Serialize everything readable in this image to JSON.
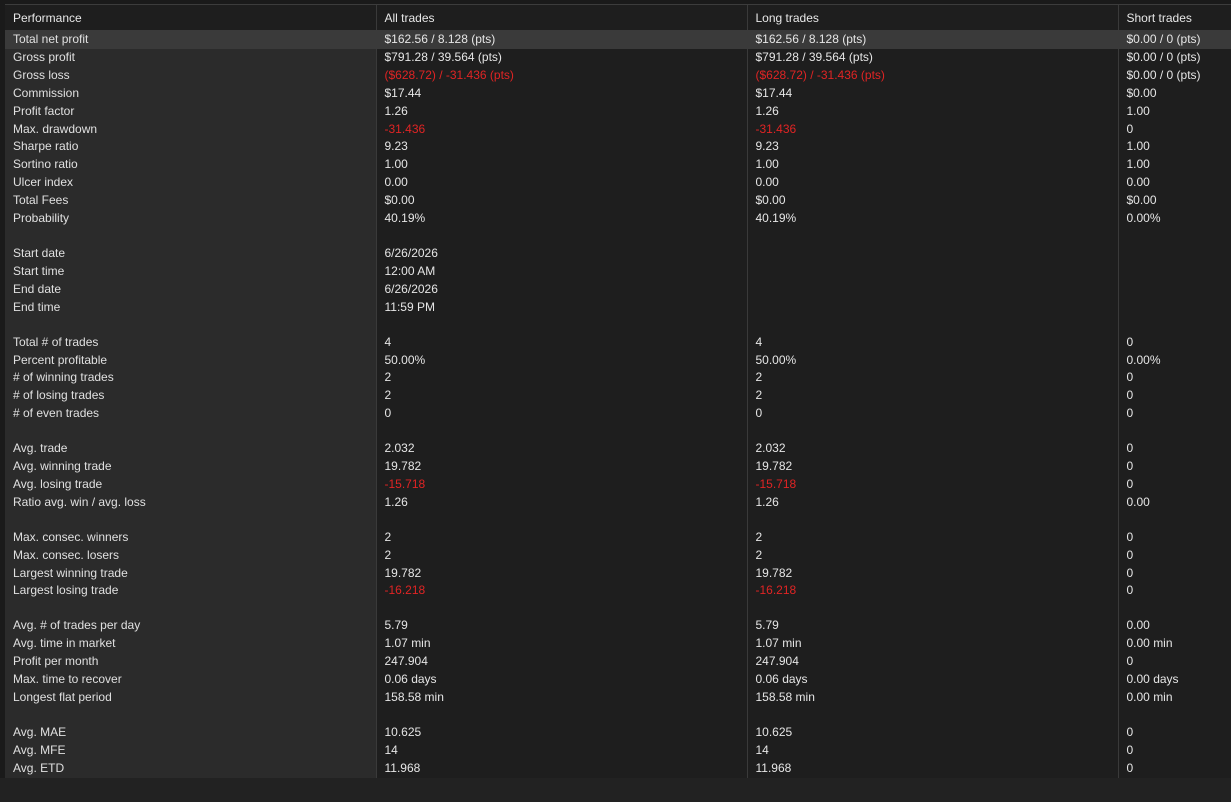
{
  "headers": [
    "Performance",
    "All trades",
    "Long trades",
    "Short trades"
  ],
  "colors": {
    "negative": "#e02424",
    "background": "#1e1e1e",
    "label_bg": "#2b2b2b",
    "selected_row": "#3a3a3a"
  },
  "rows": [
    {
      "label": "Total net profit",
      "all": "$162.56 / 8.128 (pts)",
      "long": "$162.56 / 8.128 (pts)",
      "short": "$0.00 / 0 (pts)",
      "selected": true
    },
    {
      "label": "Gross profit",
      "all": "$791.28 / 39.564 (pts)",
      "long": "$791.28 / 39.564 (pts)",
      "short": "$0.00 / 0 (pts)"
    },
    {
      "label": "Gross loss",
      "all": "($628.72) / -31.436 (pts)",
      "long": "($628.72) / -31.436 (pts)",
      "short": "$0.00 / 0 (pts)",
      "neg": true
    },
    {
      "label": "Commission",
      "all": "$17.44",
      "long": "$17.44",
      "short": "$0.00"
    },
    {
      "label": "Profit factor",
      "all": "1.26",
      "long": "1.26",
      "short": "1.00"
    },
    {
      "label": "Max. drawdown",
      "all": "-31.436",
      "long": "-31.436",
      "short": "0",
      "neg": true
    },
    {
      "label": "Sharpe ratio",
      "all": "9.23",
      "long": "9.23",
      "short": "1.00"
    },
    {
      "label": "Sortino ratio",
      "all": "1.00",
      "long": "1.00",
      "short": "1.00"
    },
    {
      "label": "Ulcer index",
      "all": "0.00",
      "long": "0.00",
      "short": "0.00"
    },
    {
      "label": "Total Fees",
      "all": "$0.00",
      "long": "$0.00",
      "short": "$0.00"
    },
    {
      "label": "Probability",
      "all": "40.19%",
      "long": "40.19%",
      "short": "0.00%"
    },
    {
      "gap": true
    },
    {
      "label": "Start date",
      "all": "6/26/2026",
      "long": "",
      "short": ""
    },
    {
      "label": "Start time",
      "all": "12:00 AM",
      "long": "",
      "short": ""
    },
    {
      "label": "End date",
      "all": "6/26/2026",
      "long": "",
      "short": ""
    },
    {
      "label": "End time",
      "all": "11:59 PM",
      "long": "",
      "short": ""
    },
    {
      "gap": true
    },
    {
      "label": "Total # of trades",
      "all": "4",
      "long": "4",
      "short": "0"
    },
    {
      "label": "Percent profitable",
      "all": "50.00%",
      "long": "50.00%",
      "short": "0.00%"
    },
    {
      "label": "# of winning trades",
      "all": "2",
      "long": "2",
      "short": "0"
    },
    {
      "label": "# of losing trades",
      "all": "2",
      "long": "2",
      "short": "0"
    },
    {
      "label": "# of even trades",
      "all": "0",
      "long": "0",
      "short": "0"
    },
    {
      "gap": true
    },
    {
      "label": "Avg. trade",
      "all": "2.032",
      "long": "2.032",
      "short": "0"
    },
    {
      "label": "Avg. winning trade",
      "all": "19.782",
      "long": "19.782",
      "short": "0"
    },
    {
      "label": "Avg. losing trade",
      "all": "-15.718",
      "long": "-15.718",
      "short": "0",
      "neg": true
    },
    {
      "label": "Ratio avg. win / avg. loss",
      "all": "1.26",
      "long": "1.26",
      "short": "0.00"
    },
    {
      "gap": true
    },
    {
      "label": "Max. consec. winners",
      "all": "2",
      "long": "2",
      "short": "0"
    },
    {
      "label": "Max. consec. losers",
      "all": "2",
      "long": "2",
      "short": "0"
    },
    {
      "label": "Largest winning trade",
      "all": "19.782",
      "long": "19.782",
      "short": "0"
    },
    {
      "label": "Largest losing trade",
      "all": "-16.218",
      "long": "-16.218",
      "short": "0",
      "neg": true
    },
    {
      "gap": true
    },
    {
      "label": "Avg. # of trades per day",
      "all": "5.79",
      "long": "5.79",
      "short": "0.00"
    },
    {
      "label": "Avg. time in market",
      "all": "1.07 min",
      "long": "1.07 min",
      "short": "0.00 min"
    },
    {
      "label": "Profit per month",
      "all": "247.904",
      "long": "247.904",
      "short": "0"
    },
    {
      "label": "Max. time to recover",
      "all": "0.06 days",
      "long": "0.06 days",
      "short": "0.00 days"
    },
    {
      "label": "Longest flat period",
      "all": "158.58 min",
      "long": "158.58 min",
      "short": "0.00 min"
    },
    {
      "gap": true
    },
    {
      "label": "Avg. MAE",
      "all": "10.625",
      "long": "10.625",
      "short": "0"
    },
    {
      "label": "Avg. MFE",
      "all": "14",
      "long": "14",
      "short": "0"
    },
    {
      "label": "Avg. ETD",
      "all": "11.968",
      "long": "11.968",
      "short": "0"
    }
  ]
}
